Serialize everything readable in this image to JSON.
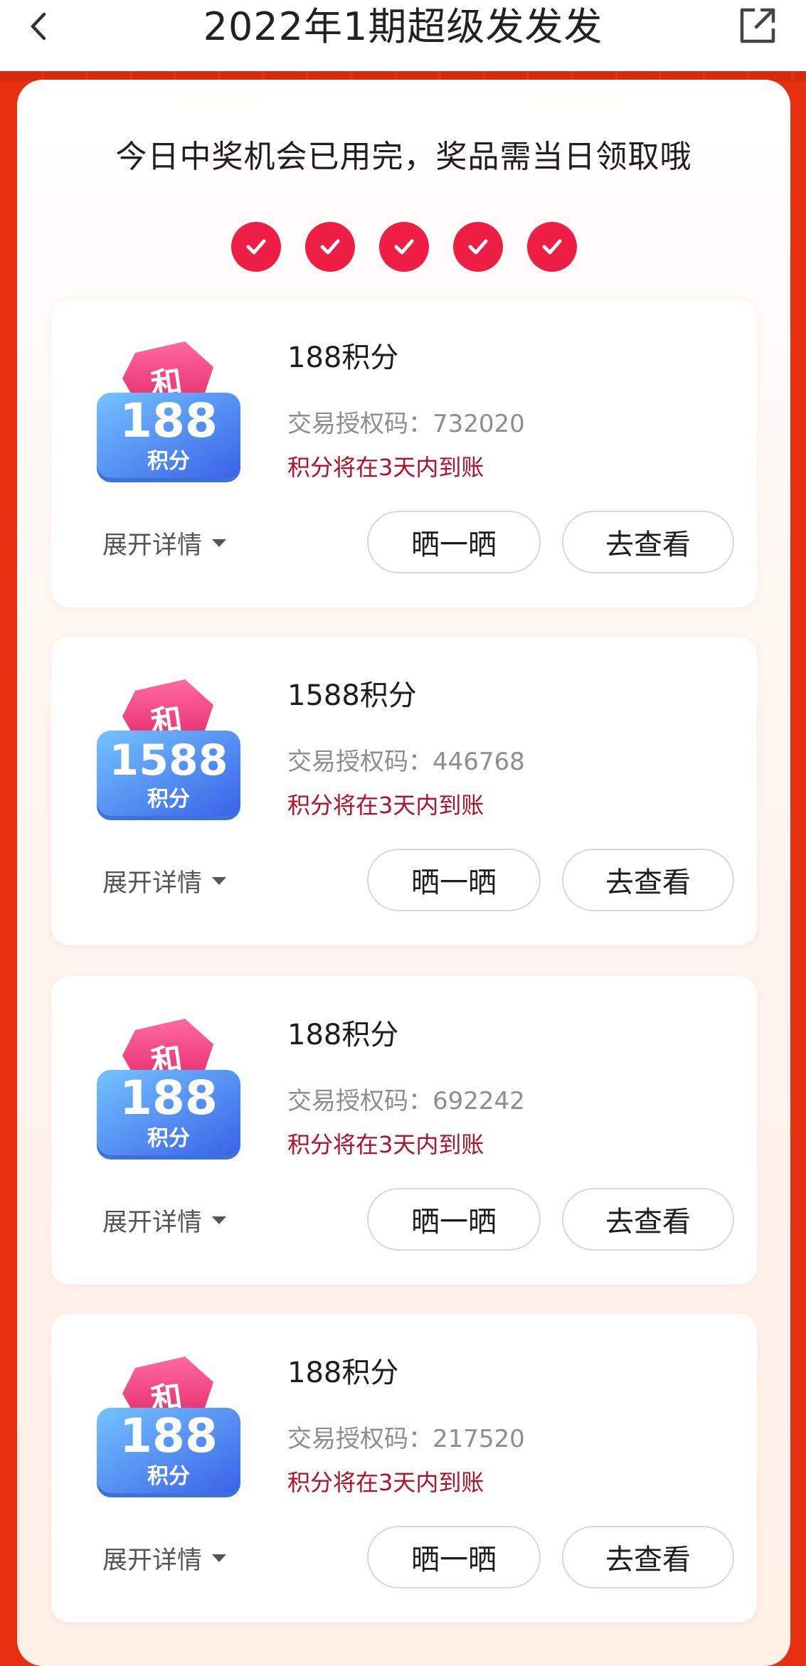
{
  "header": {
    "title": "2022年1期超级发发发"
  },
  "notice": "今日中奖机会已用完，奖品需当日领取哦",
  "checks_total": 5,
  "labels": {
    "code_prefix": "交易授权码：",
    "expand": "展开详情",
    "share": "晒一晒",
    "view": "去查看",
    "badge_top": "和",
    "badge_bottom": "积分"
  },
  "colors": {
    "accent_red": "#ee1e45",
    "background_red": "#e6300f",
    "note_red": "#b3102a"
  },
  "prizes": [
    {
      "name": "188积分",
      "badge_value": "188",
      "code": "732020",
      "note": "积分将在3天内到账"
    },
    {
      "name": "1588积分",
      "badge_value": "1588",
      "code": "446768",
      "note": "积分将在3天内到账"
    },
    {
      "name": "188积分",
      "badge_value": "188",
      "code": "692242",
      "note": "积分将在3天内到账"
    },
    {
      "name": "188积分",
      "badge_value": "188",
      "code": "217520",
      "note": "积分将在3天内到账"
    }
  ]
}
